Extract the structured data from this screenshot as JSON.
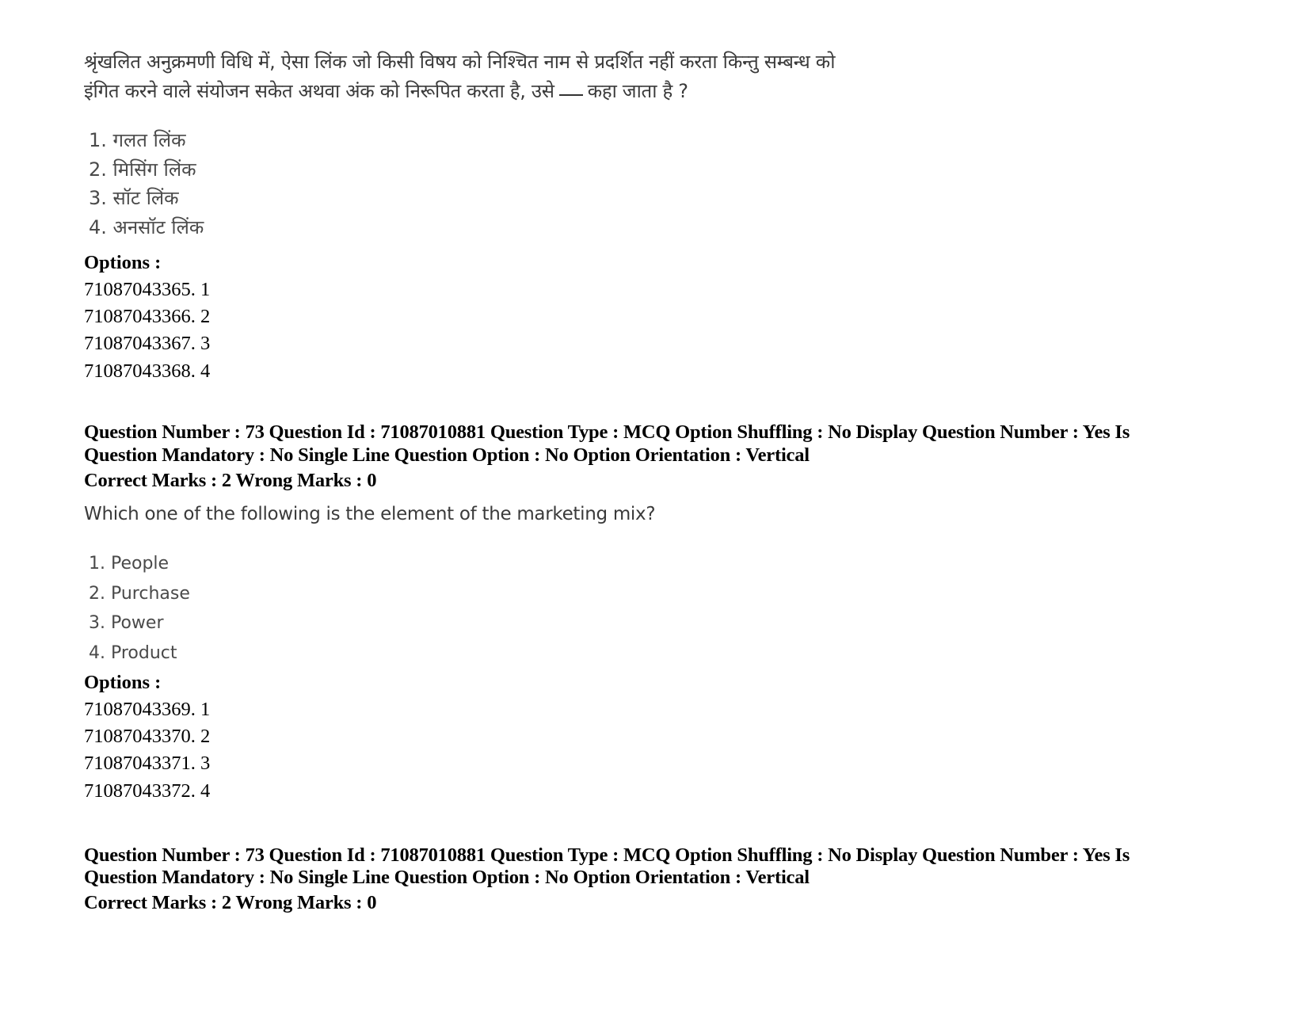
{
  "question_72_continued": {
    "text_line_1": "श्रृंखलित अनुक्रमणी विधि में, ऐसा लिंक जो किसी विषय को निश्चित नाम से प्रदर्शित नहीं करता किन्तु सम्बन्ध को",
    "text_line_2_before_blank": "इंगित करने वाले संयोजन सकेत अथवा अंक को निरूपित करता है, उसे",
    "text_line_2_after_blank": "कहा जाता है ?",
    "choices": [
      "1. गलत लिंक",
      "2. मिसिंग लिंक",
      "3. सॉट लिंक",
      "4. अनसॉट लिंक"
    ],
    "options_label": "Options :",
    "option_ids": [
      "71087043365. 1",
      "71087043366. 2",
      "71087043367. 3",
      "71087043368. 4"
    ]
  },
  "question_73": {
    "meta_line_1": "Question Number : 73 Question Id : 71087010881 Question Type : MCQ Option Shuffling : No Display Question Number : Yes Is",
    "meta_line_2": "Question Mandatory : No Single Line Question Option : No Option Orientation : Vertical",
    "marks_line": "Correct Marks : 2 Wrong Marks : 0",
    "text": "Which one of the following is the element of the marketing mix?",
    "choices": [
      "1. People",
      "2. Purchase",
      "3. Power",
      "4. Product"
    ],
    "options_label": "Options :",
    "option_ids": [
      "71087043369. 1",
      "71087043370. 2",
      "71087043371. 3",
      "71087043372. 4"
    ]
  },
  "question_73_hindi_header": {
    "meta_line_1": "Question Number : 73 Question Id : 71087010881 Question Type : MCQ Option Shuffling : No Display Question Number : Yes Is",
    "meta_line_2": "Question Mandatory : No Single Line Question Option : No Option Orientation : Vertical",
    "marks_line": "Correct Marks : 2 Wrong Marks : 0"
  }
}
